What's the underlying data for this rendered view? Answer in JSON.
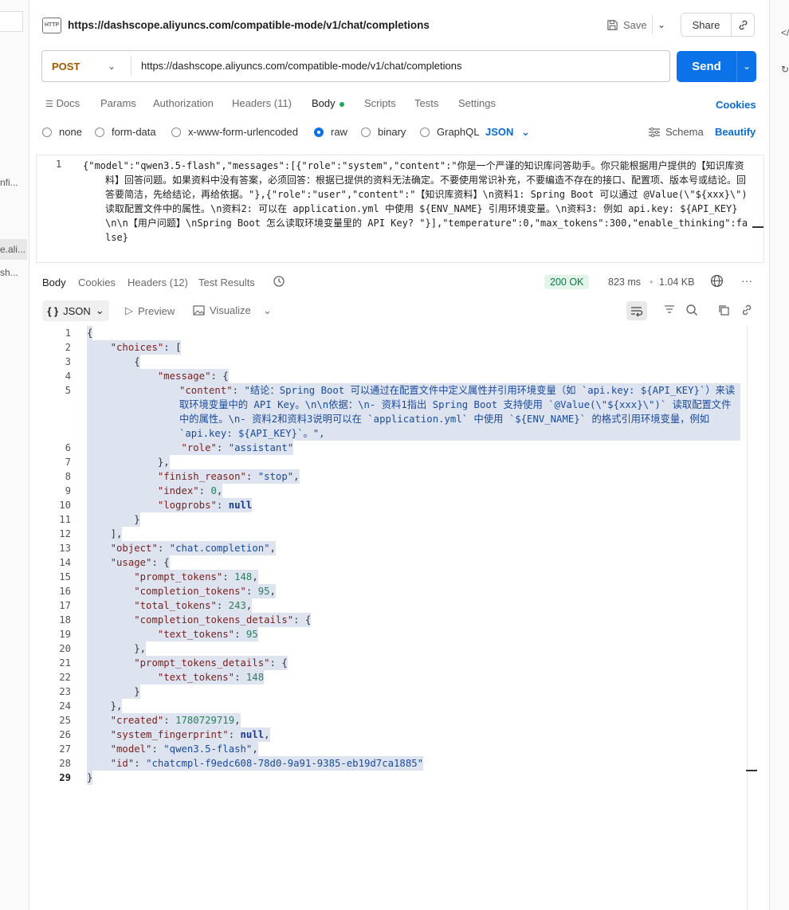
{
  "left_panel": {
    "fragments": [
      "nfi...",
      "e.ali...",
      "sh..."
    ]
  },
  "right_panel": {
    "icons": [
      "code-icon",
      "history-icon"
    ]
  },
  "header": {
    "title": "https://dashscope.aliyuncs.com/compatible-mode/v1/chat/completions",
    "save_label": "Save",
    "share_label": "Share"
  },
  "request": {
    "method": "POST",
    "url": "https://dashscope.aliyuncs.com/compatible-mode/v1/chat/completions",
    "send_label": "Send",
    "tabs": [
      "Docs",
      "Params",
      "Authorization",
      "Headers (11)",
      "Body",
      "Scripts",
      "Tests",
      "Settings"
    ],
    "active_tab": "Body",
    "cookies_label": "Cookies",
    "body_types": [
      "none",
      "form-data",
      "x-www-form-urlencoded",
      "raw",
      "binary",
      "GraphQL"
    ],
    "selected_body_type": "raw",
    "format": "JSON",
    "schema_label": "Schema",
    "beautify_label": "Beautify",
    "body_line_number": "1",
    "body_text": "{\"model\":\"qwen3.5-flash\",\"messages\":[{\"role\":\"system\",\"content\":\"你是一个严谨的知识库问答助手。你只能根据用户提供的【知识库资料】回答问题。如果资料中没有答案，必须回答：根据已提供的资料无法确定。不要使用常识补充，不要编造不存在的接口、配置项、版本号或结论。回答要简洁，先给结论，再给依据。\"},{\"role\":\"user\",\"content\":\"【知识库资料】\\n资料1: Spring Boot 可以通过 @Value(\\\"${xxx}\\\") 读取配置文件中的属性。\\n资料2: 可以在 application.yml 中使用 ${ENV_NAME} 引用环境变量。\\n资料3: 例如 api.key: ${API_KEY}\\n\\n【用户问题】\\nSpring Boot 怎么读取环境变量里的 API Key? \"}],\"temperature\":0,\"max_tokens\":300,\"enable_thinking\":false}"
  },
  "response": {
    "tabs": [
      "Body",
      "Cookies",
      "Headers (12)",
      "Test Results"
    ],
    "active_tab": "Body",
    "status": "200 OK",
    "time": "823 ms",
    "size": "1.04 KB",
    "format_label": "JSON",
    "preview_label": "Preview",
    "visualize_label": "Visualize",
    "line_count": 29,
    "json": {
      "content_value": "结论：Spring Boot 可以通过在配置文件中定义属性并引用环境变量（如 `api.key: ${API_KEY}`）来读取环境变量中的 API Key。\\n\\n依据：\\n- 资料1指出 Spring Boot 支持使用 `@Value(\\\"${xxx}\\\")` 读取配置文件中的属性。\\n- 资料2和资料3说明可以在 `application.yml` 中使用 `${ENV_NAME}` 的格式引用环境变量，例如 `api.key: ${API_KEY}`。",
      "role": "assistant",
      "finish_reason": "stop",
      "index": "0",
      "logprobs": "null",
      "object": "chat.completion",
      "prompt_tokens": "148",
      "completion_tokens": "95",
      "total_tokens": "243",
      "text_tokens_completion": "95",
      "text_tokens_prompt": "148",
      "created": "1780729719",
      "system_fingerprint": "null",
      "model": "qwen3.5-flash",
      "id": "chatcmpl-f9edc608-78d0-9a91-9385-eb19d7ca1885"
    }
  },
  "colors": {
    "accent": "#0b72e7",
    "status_ok": "#0b7a3e",
    "method_post": "#a05a00"
  }
}
